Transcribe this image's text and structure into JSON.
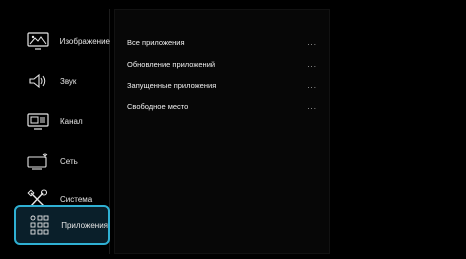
{
  "sidebar": {
    "items": [
      {
        "label": "Изображение",
        "icon": "image-icon"
      },
      {
        "label": "Звук",
        "icon": "speaker-icon"
      },
      {
        "label": "Канал",
        "icon": "channel-icon"
      },
      {
        "label": "Сеть",
        "icon": "network-icon"
      },
      {
        "label": "Система",
        "icon": "tools-icon"
      },
      {
        "label": "Приложения",
        "icon": "apps-grid-icon"
      }
    ],
    "active_item": "Приложения"
  },
  "panel": {
    "items": [
      {
        "label": "Все приложения",
        "more": "..."
      },
      {
        "label": "Обновление приложений",
        "more": "..."
      },
      {
        "label": "Запущенные приложения",
        "more": "..."
      },
      {
        "label": "Свободное место",
        "more": "..."
      }
    ]
  },
  "colors": {
    "accent": "#2fb0d3",
    "background": "#000000",
    "text": "#e6e6e6"
  }
}
